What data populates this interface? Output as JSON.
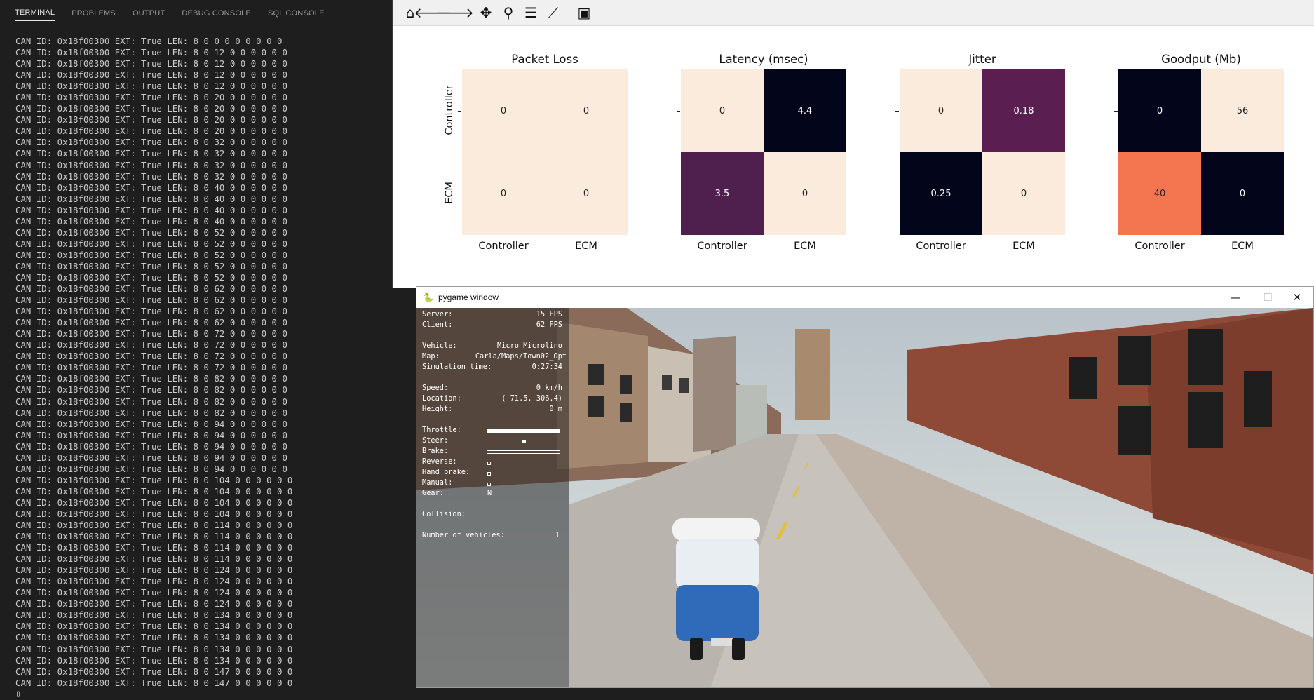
{
  "terminal": {
    "tabs": [
      "TERMINAL",
      "PROBLEMS",
      "OUTPUT",
      "DEBUG CONSOLE",
      "SQL CONSOLE"
    ],
    "active_tab": "TERMINAL",
    "lines": [
      "CAN ID: 0x18f00300 EXT: True LEN: 8 0 0 0 0 0 0 0 0",
      "CAN ID: 0x18f00300 EXT: True LEN: 8 0 12 0 0 0 0 0 0",
      "CAN ID: 0x18f00300 EXT: True LEN: 8 0 12 0 0 0 0 0 0",
      "CAN ID: 0x18f00300 EXT: True LEN: 8 0 12 0 0 0 0 0 0",
      "CAN ID: 0x18f00300 EXT: True LEN: 8 0 12 0 0 0 0 0 0",
      "CAN ID: 0x18f00300 EXT: True LEN: 8 0 20 0 0 0 0 0 0",
      "CAN ID: 0x18f00300 EXT: True LEN: 8 0 20 0 0 0 0 0 0",
      "CAN ID: 0x18f00300 EXT: True LEN: 8 0 20 0 0 0 0 0 0",
      "CAN ID: 0x18f00300 EXT: True LEN: 8 0 20 0 0 0 0 0 0",
      "CAN ID: 0x18f00300 EXT: True LEN: 8 0 32 0 0 0 0 0 0",
      "CAN ID: 0x18f00300 EXT: True LEN: 8 0 32 0 0 0 0 0 0",
      "CAN ID: 0x18f00300 EXT: True LEN: 8 0 32 0 0 0 0 0 0",
      "CAN ID: 0x18f00300 EXT: True LEN: 8 0 32 0 0 0 0 0 0",
      "CAN ID: 0x18f00300 EXT: True LEN: 8 0 40 0 0 0 0 0 0",
      "CAN ID: 0x18f00300 EXT: True LEN: 8 0 40 0 0 0 0 0 0",
      "CAN ID: 0x18f00300 EXT: True LEN: 8 0 40 0 0 0 0 0 0",
      "CAN ID: 0x18f00300 EXT: True LEN: 8 0 40 0 0 0 0 0 0",
      "CAN ID: 0x18f00300 EXT: True LEN: 8 0 52 0 0 0 0 0 0",
      "CAN ID: 0x18f00300 EXT: True LEN: 8 0 52 0 0 0 0 0 0",
      "CAN ID: 0x18f00300 EXT: True LEN: 8 0 52 0 0 0 0 0 0",
      "CAN ID: 0x18f00300 EXT: True LEN: 8 0 52 0 0 0 0 0 0",
      "CAN ID: 0x18f00300 EXT: True LEN: 8 0 52 0 0 0 0 0 0",
      "CAN ID: 0x18f00300 EXT: True LEN: 8 0 62 0 0 0 0 0 0",
      "CAN ID: 0x18f00300 EXT: True LEN: 8 0 62 0 0 0 0 0 0",
      "CAN ID: 0x18f00300 EXT: True LEN: 8 0 62 0 0 0 0 0 0",
      "CAN ID: 0x18f00300 EXT: True LEN: 8 0 62 0 0 0 0 0 0",
      "CAN ID: 0x18f00300 EXT: True LEN: 8 0 72 0 0 0 0 0 0",
      "CAN ID: 0x18f00300 EXT: True LEN: 8 0 72 0 0 0 0 0 0",
      "CAN ID: 0x18f00300 EXT: True LEN: 8 0 72 0 0 0 0 0 0",
      "CAN ID: 0x18f00300 EXT: True LEN: 8 0 72 0 0 0 0 0 0",
      "CAN ID: 0x18f00300 EXT: True LEN: 8 0 82 0 0 0 0 0 0",
      "CAN ID: 0x18f00300 EXT: True LEN: 8 0 82 0 0 0 0 0 0",
      "CAN ID: 0x18f00300 EXT: True LEN: 8 0 82 0 0 0 0 0 0",
      "CAN ID: 0x18f00300 EXT: True LEN: 8 0 82 0 0 0 0 0 0",
      "CAN ID: 0x18f00300 EXT: True LEN: 8 0 94 0 0 0 0 0 0",
      "CAN ID: 0x18f00300 EXT: True LEN: 8 0 94 0 0 0 0 0 0",
      "CAN ID: 0x18f00300 EXT: True LEN: 8 0 94 0 0 0 0 0 0",
      "CAN ID: 0x18f00300 EXT: True LEN: 8 0 94 0 0 0 0 0 0",
      "CAN ID: 0x18f00300 EXT: True LEN: 8 0 94 0 0 0 0 0 0",
      "CAN ID: 0x18f00300 EXT: True LEN: 8 0 104 0 0 0 0 0 0",
      "CAN ID: 0x18f00300 EXT: True LEN: 8 0 104 0 0 0 0 0 0",
      "CAN ID: 0x18f00300 EXT: True LEN: 8 0 104 0 0 0 0 0 0",
      "CAN ID: 0x18f00300 EXT: True LEN: 8 0 104 0 0 0 0 0 0",
      "CAN ID: 0x18f00300 EXT: True LEN: 8 0 114 0 0 0 0 0 0",
      "CAN ID: 0x18f00300 EXT: True LEN: 8 0 114 0 0 0 0 0 0",
      "CAN ID: 0x18f00300 EXT: True LEN: 8 0 114 0 0 0 0 0 0",
      "CAN ID: 0x18f00300 EXT: True LEN: 8 0 114 0 0 0 0 0 0",
      "CAN ID: 0x18f00300 EXT: True LEN: 8 0 124 0 0 0 0 0 0",
      "CAN ID: 0x18f00300 EXT: True LEN: 8 0 124 0 0 0 0 0 0",
      "CAN ID: 0x18f00300 EXT: True LEN: 8 0 124 0 0 0 0 0 0",
      "CAN ID: 0x18f00300 EXT: True LEN: 8 0 124 0 0 0 0 0 0",
      "CAN ID: 0x18f00300 EXT: True LEN: 8 0 134 0 0 0 0 0 0",
      "CAN ID: 0x18f00300 EXT: True LEN: 8 0 134 0 0 0 0 0 0",
      "CAN ID: 0x18f00300 EXT: True LEN: 8 0 134 0 0 0 0 0 0",
      "CAN ID: 0x18f00300 EXT: True LEN: 8 0 134 0 0 0 0 0 0",
      "CAN ID: 0x18f00300 EXT: True LEN: 8 0 134 0 0 0 0 0 0",
      "CAN ID: 0x18f00300 EXT: True LEN: 8 0 147 0 0 0 0 0 0",
      "CAN ID: 0x18f00300 EXT: True LEN: 8 0 147 0 0 0 0 0 0"
    ]
  },
  "figure": {
    "toolbar_icons": [
      "home-icon",
      "back-icon",
      "forward-icon",
      "pan-icon",
      "zoom-icon",
      "configure-subplots-icon",
      "edit-axis-icon",
      "save-icon"
    ]
  },
  "chart_data": [
    {
      "type": "heatmap",
      "title": "Packet Loss",
      "x_categories": [
        "Controller",
        "ECM"
      ],
      "y_categories": [
        "Controller",
        "ECM"
      ],
      "values": [
        [
          0,
          0
        ],
        [
          0,
          0
        ]
      ],
      "cell_colors": [
        [
          "#faebdd",
          "#faebdd"
        ],
        [
          "#faebdd",
          "#faebdd"
        ]
      ],
      "labels": [
        [
          "0",
          "0"
        ],
        [
          "0",
          "0"
        ]
      ]
    },
    {
      "type": "heatmap",
      "title": "Latency (msec)",
      "x_categories": [
        "Controller",
        "ECM"
      ],
      "y_categories": [
        "Controller",
        "ECM"
      ],
      "values": [
        [
          0,
          4.4
        ],
        [
          3.5,
          0
        ]
      ],
      "cell_colors": [
        [
          "#faebdd",
          "#03051a"
        ],
        [
          "#4f1f4e",
          "#faebdd"
        ]
      ],
      "labels": [
        [
          "0",
          "4.4"
        ],
        [
          "3.5",
          "0"
        ]
      ]
    },
    {
      "type": "heatmap",
      "title": "Jitter",
      "x_categories": [
        "Controller",
        "ECM"
      ],
      "y_categories": [
        "Controller",
        "ECM"
      ],
      "values": [
        [
          0,
          0.18
        ],
        [
          0.25,
          0
        ]
      ],
      "cell_colors": [
        [
          "#faebdd",
          "#5b1e51"
        ],
        [
          "#03051a",
          "#faebdd"
        ]
      ],
      "labels": [
        [
          "0",
          "0.18"
        ],
        [
          "0.25",
          "0"
        ]
      ]
    },
    {
      "type": "heatmap",
      "title": "Goodput (Mb)",
      "x_categories": [
        "Controller",
        "ECM"
      ],
      "y_categories": [
        "Controller",
        "ECM"
      ],
      "values": [
        [
          0,
          56
        ],
        [
          40,
          0
        ]
      ],
      "cell_colors": [
        [
          "#03051a",
          "#faebdd"
        ],
        [
          "#f37651",
          "#03051a"
        ]
      ],
      "labels": [
        [
          "0",
          "56"
        ],
        [
          "40",
          "0"
        ]
      ]
    }
  ],
  "pygame": {
    "title": "pygame window",
    "controls": {
      "minimize": "—",
      "maximize": "☐",
      "close": "✕"
    },
    "hud": {
      "server_label": "Server:",
      "server_value": "15 FPS",
      "client_label": "Client:",
      "client_value": "62 FPS",
      "vehicle_label": "Vehicle:",
      "vehicle_value": "Micro Microlino",
      "map_label": "Map:",
      "map_value": "Carla/Maps/Town02_Opt",
      "simtime_label": "Simulation time:",
      "simtime_value": "0:27:34",
      "speed_label": "Speed:",
      "speed_value": "0 km/h",
      "location_label": "Location:",
      "location_value": "( 71.5, 306.4)",
      "height_label": "Height:",
      "height_value": "0 m",
      "throttle_label": "Throttle:",
      "steer_label": "Steer:",
      "brake_label": "Brake:",
      "reverse_label": "Reverse:",
      "handbrake_label": "Hand brake:",
      "manual_label": "Manual:",
      "gear_label": "Gear:",
      "gear_value": "N",
      "collision_label": "Collision:",
      "vehicles_label": "Number of vehicles:",
      "vehicles_value": "1",
      "throttle_level": 1.0,
      "steer_level": 0.5,
      "brake_level": 0.0
    }
  }
}
